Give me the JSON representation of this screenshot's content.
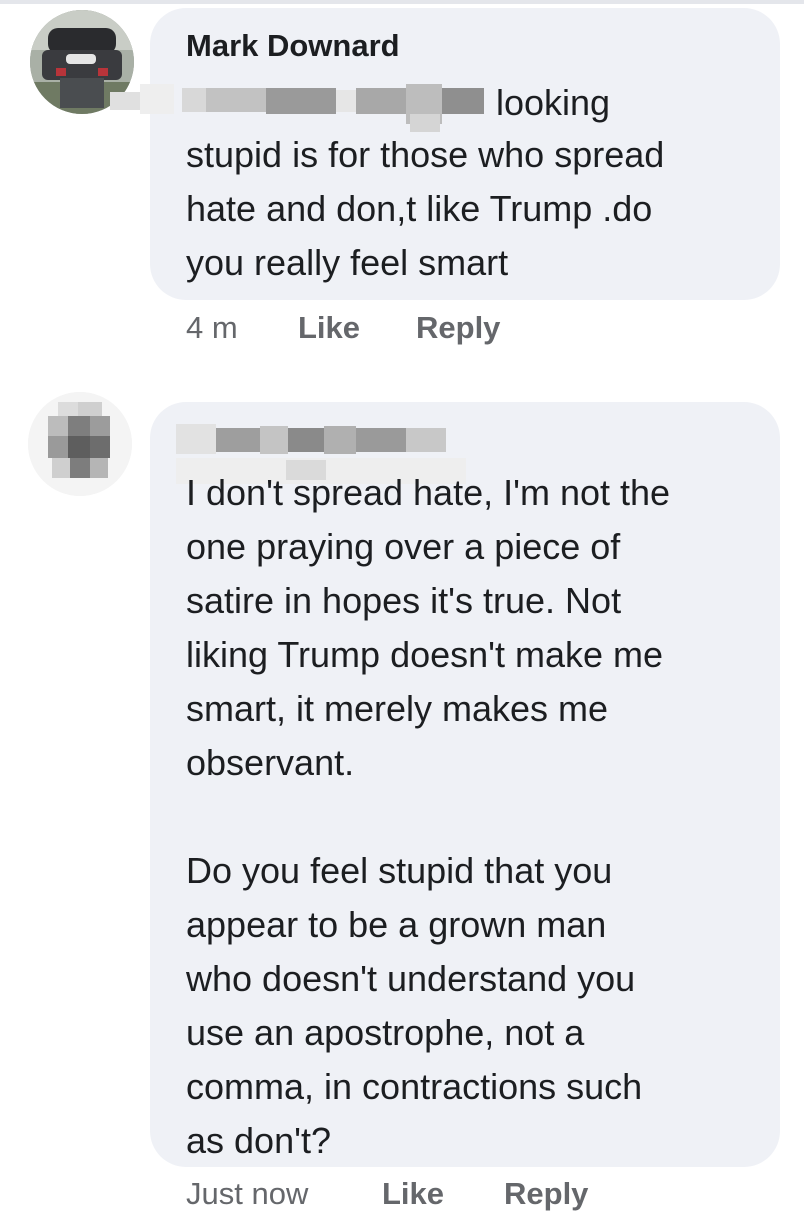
{
  "comment1": {
    "author": "Mark Downard",
    "first_line_visible": "looking",
    "body": "stupid is for those who spread\nhate and don,t like Trump .do\nyou really feel smart",
    "timestamp": "4 m",
    "like_label": "Like",
    "reply_label": "Reply"
  },
  "comment2": {
    "partial_first_line": "I don't spread hate, I'm not the",
    "body": "one praying over a piece of\nsatire in hopes it's true. Not\nliking Trump doesn't make me\nsmart, it merely makes me\nobservant.\n\nDo you feel stupid that you\nappear to be a grown man\nwho doesn't understand you\nuse an apostrophe, not a\ncomma, in contractions such\nas don't?",
    "timestamp": "Just now",
    "like_label": "Like",
    "reply_label": "Reply"
  },
  "colors": {
    "bubble_bg": "#eff1f6",
    "text": "#1c1e21",
    "secondary_text": "#65676b"
  }
}
